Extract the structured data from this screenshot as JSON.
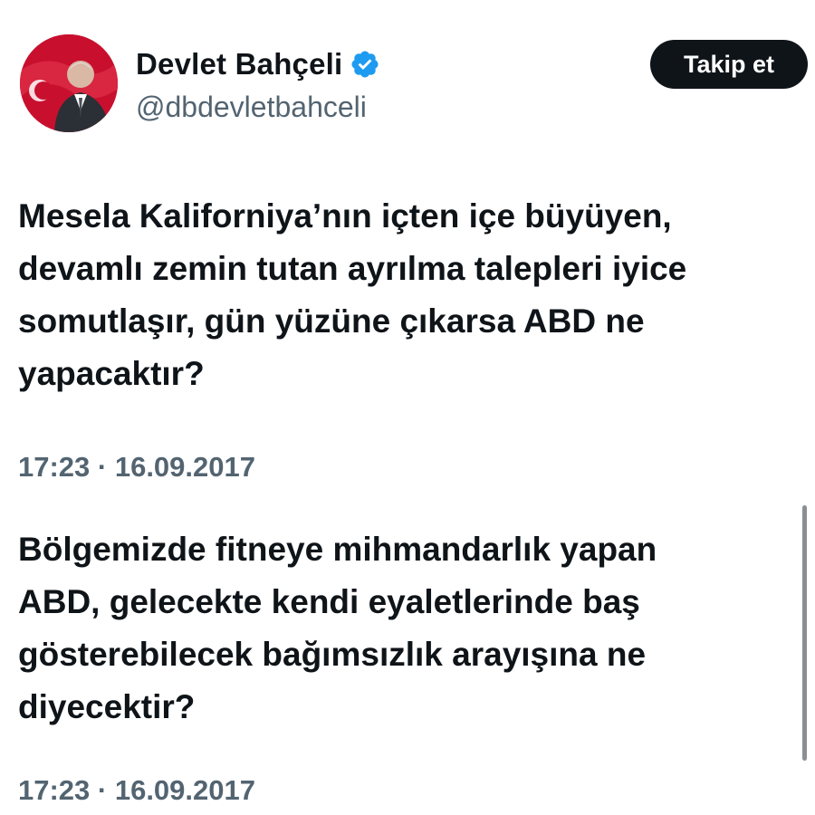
{
  "profile": {
    "display_name": "Devlet Bahçeli",
    "handle": "@dbdevletbahceli",
    "verified_icon": "verified-badge-icon",
    "avatar": "profile-photo"
  },
  "follow_button": {
    "label": "Takip et"
  },
  "tweets": [
    {
      "text": "Mesela Kaliforniya’nın içten içe büyüyen,\ndevamlı zemin tutan ayrılma talepleri iyice\nsomutlaşır, gün yüzüne çıkarsa ABD ne\nyapacaktır?",
      "timestamp": "17:23 · 16.09.2017"
    },
    {
      "text": "Bölgemizde fitneye mihmandarlık yapan\nABD, gelecekte kendi eyaletlerinde baş\ngösterebilecek bağımsızlık arayışına ne\ndiyecektir?",
      "timestamp": "17:23 · 16.09.2017"
    }
  ],
  "colors": {
    "text_primary": "#0f1419",
    "text_secondary": "#536471",
    "verified_blue": "#1d9bf0",
    "button_bg": "#0f1419",
    "avatar_flag_red": "#c8102e"
  }
}
